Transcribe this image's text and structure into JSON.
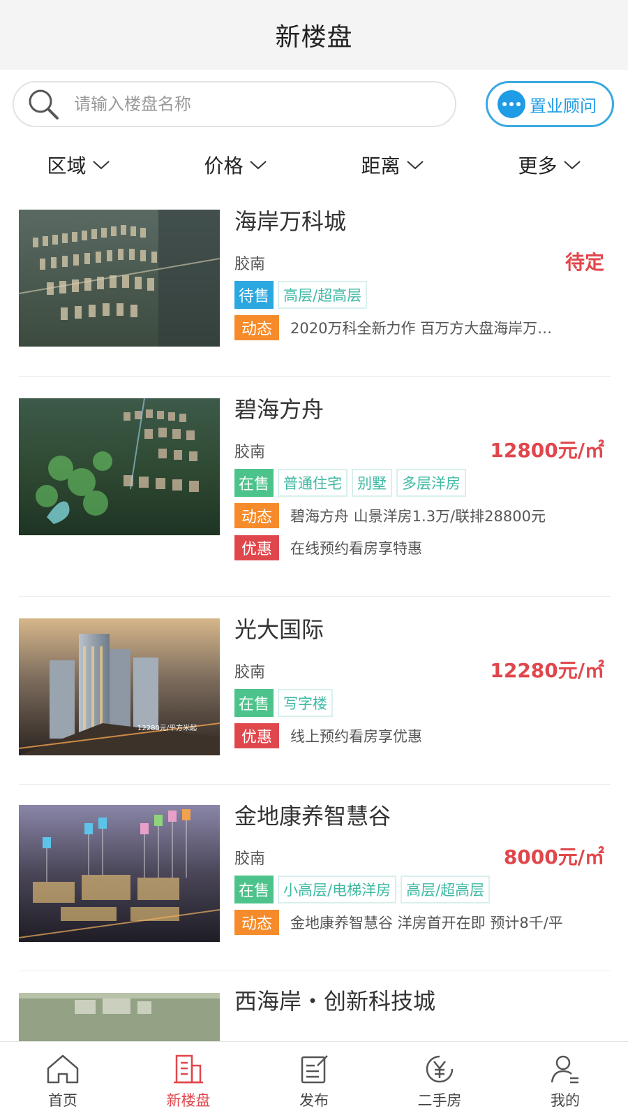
{
  "header": {
    "title": "新楼盘"
  },
  "search": {
    "placeholder": "请输入楼盘名称",
    "advisor_label": "置业顾问"
  },
  "filters": [
    {
      "label": "区域"
    },
    {
      "label": "价格"
    },
    {
      "label": "距离"
    },
    {
      "label": "更多"
    }
  ],
  "listings": [
    {
      "name": "海岸万科城",
      "district": "胶南",
      "price": "待定",
      "status": "待售",
      "types": [
        "高层/超高层"
      ],
      "notes": [
        {
          "badge": "动态",
          "text": "2020万科全新力作 百万方大盘海岸万…"
        }
      ]
    },
    {
      "name": "碧海方舟",
      "district": "胶南",
      "price": "12800元/㎡",
      "status": "在售",
      "types": [
        "普通住宅",
        "别墅",
        "多层洋房"
      ],
      "notes": [
        {
          "badge": "动态",
          "text": "碧海方舟 山景洋房1.3万/联排28800元"
        },
        {
          "badge": "优惠",
          "text": "在线预约看房享特惠"
        }
      ]
    },
    {
      "name": "光大国际",
      "district": "胶南",
      "price": "12280元/㎡",
      "status": "在售",
      "types": [
        "写字楼"
      ],
      "notes": [
        {
          "badge": "优惠",
          "text": "线上预约看房享优惠"
        }
      ],
      "image_caption": "12280元/平方米起"
    },
    {
      "name": "金地康养智慧谷",
      "district": "胶南",
      "price": "8000元/㎡",
      "status": "在售",
      "types": [
        "小高层/电梯洋房",
        "高层/超高层"
      ],
      "notes": [
        {
          "badge": "动态",
          "text": "金地康养智慧谷 洋房首开在即 预计8千/平"
        }
      ]
    },
    {
      "name": "西海岸・创新科技城"
    }
  ],
  "tabbar": [
    {
      "label": "首页",
      "icon": "home-icon"
    },
    {
      "label": "新楼盘",
      "icon": "building-icon",
      "active": true
    },
    {
      "label": "发布",
      "icon": "edit-icon"
    },
    {
      "label": "二手房",
      "icon": "yen-icon"
    },
    {
      "label": "我的",
      "icon": "user-icon"
    }
  ],
  "colors": {
    "price_red": "#e0474c",
    "accent_blue": "#1e9ce6",
    "status_green": "#4cc38a",
    "status_blue": "#2ba8e0",
    "dynamic_orange": "#f68b2b",
    "type_teal": "#3fb9a3"
  }
}
